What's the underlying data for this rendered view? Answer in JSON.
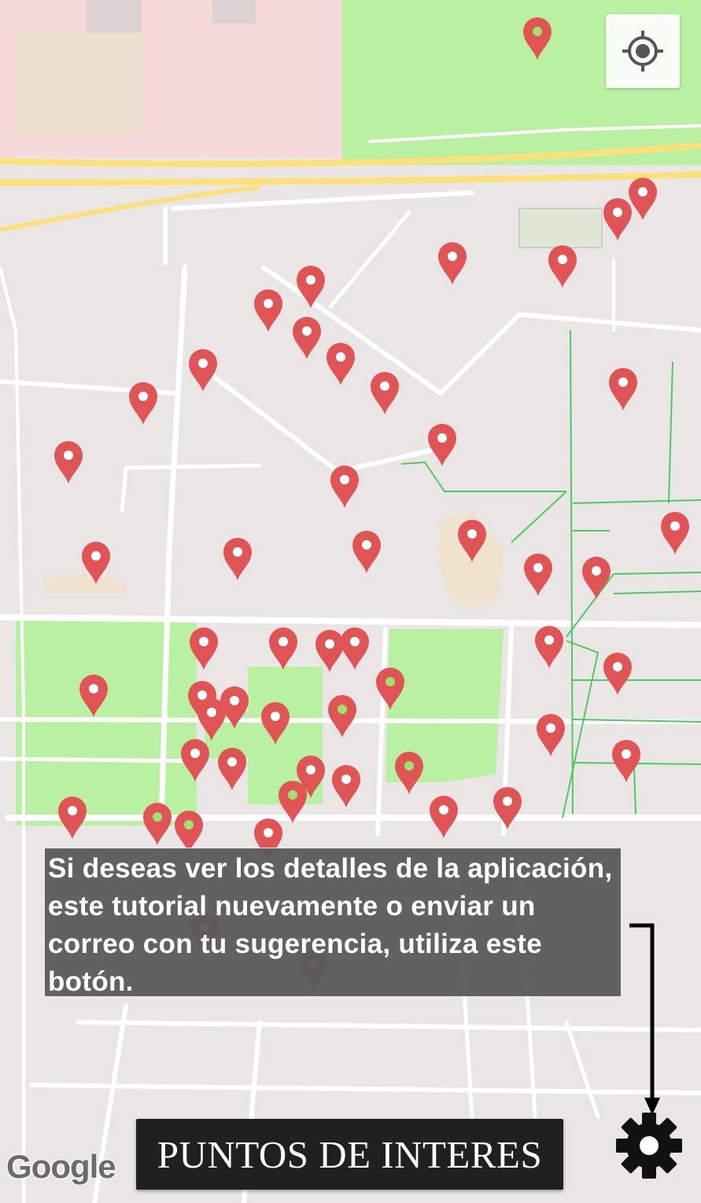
{
  "map": {
    "colors": {
      "background": "#ebe6e6",
      "urban_zone": "#f6dada",
      "park": "#b9f0a1",
      "building": "#e8dcc8",
      "highway": "#fce07a",
      "road": "#ffffff",
      "footpath": "#4fc862",
      "pin": "#e15456"
    },
    "pins": [
      {
        "variant": "green-dot"
      },
      {
        "variant": "red"
      },
      {
        "variant": "red"
      },
      {
        "variant": "red"
      },
      {
        "variant": "red"
      },
      {
        "variant": "red"
      },
      {
        "variant": "red"
      },
      {
        "variant": "red"
      },
      {
        "variant": "red"
      },
      {
        "variant": "red"
      },
      {
        "variant": "red"
      },
      {
        "variant": "red"
      },
      {
        "variant": "red"
      },
      {
        "variant": "red"
      },
      {
        "variant": "red"
      },
      {
        "variant": "red"
      },
      {
        "variant": "red"
      },
      {
        "variant": "red"
      },
      {
        "variant": "red"
      },
      {
        "variant": "red"
      },
      {
        "variant": "red"
      },
      {
        "variant": "red"
      },
      {
        "variant": "red"
      },
      {
        "variant": "red"
      },
      {
        "variant": "red"
      },
      {
        "variant": "red"
      },
      {
        "variant": "red"
      },
      {
        "variant": "red"
      },
      {
        "variant": "green-dot"
      },
      {
        "variant": "red"
      },
      {
        "variant": "red"
      },
      {
        "variant": "red"
      },
      {
        "variant": "red"
      },
      {
        "variant": "red"
      },
      {
        "variant": "red"
      },
      {
        "variant": "green-dot"
      },
      {
        "variant": "red"
      },
      {
        "variant": "red"
      },
      {
        "variant": "red"
      },
      {
        "variant": "red"
      },
      {
        "variant": "red"
      },
      {
        "variant": "green-dot"
      },
      {
        "variant": "red"
      },
      {
        "variant": "green-dot"
      },
      {
        "variant": "red"
      },
      {
        "variant": "red"
      },
      {
        "variant": "green-dot"
      },
      {
        "variant": "red"
      },
      {
        "variant": "green-dot"
      },
      {
        "variant": "red"
      },
      {
        "variant": "red"
      },
      {
        "variant": "red"
      },
      {
        "variant": "green-dot"
      },
      {
        "variant": "green-dot"
      },
      {
        "variant": "red"
      },
      {
        "variant": "red"
      },
      {
        "variant": "red"
      },
      {
        "variant": "red"
      }
    ]
  },
  "locate_button": {
    "icon": "my-location-icon"
  },
  "tutorial": {
    "text": "Si deseas ver los detalles de la aplicación, este tutorial nuevamente o enviar un correo con tu sugerencia, utiliza este botón."
  },
  "poi_button": {
    "label": "PUNTOS DE INTERES"
  },
  "settings_button": {
    "icon": "gear-icon"
  },
  "attribution": {
    "logo_text": "Google"
  }
}
